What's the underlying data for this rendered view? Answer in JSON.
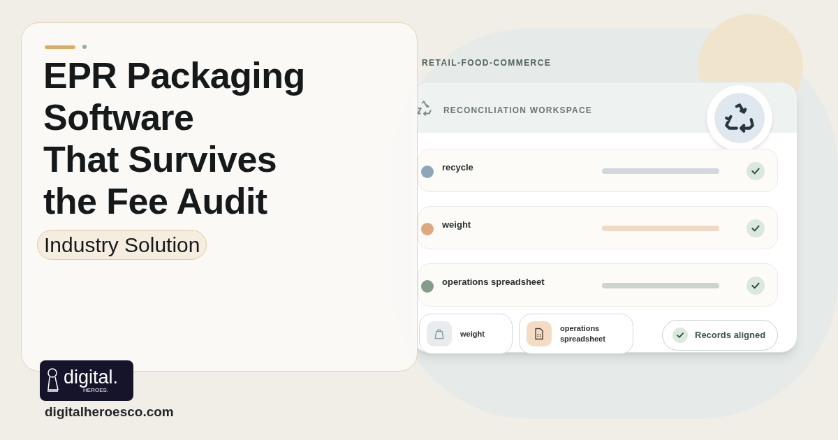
{
  "hero": {
    "title_lines": [
      "EPR Packaging",
      "Software",
      "That Survives",
      "the Fee Audit"
    ],
    "tag": "Industry Solution"
  },
  "panel": {
    "category": "RETAIL-FOOD-COMMERCE",
    "header": "RECONCILIATION WORKSPACE",
    "rows": [
      {
        "label": "recycle",
        "color": "#8fa5b8"
      },
      {
        "label": "weight",
        "color": "#dcaa7e"
      },
      {
        "label": "operations spreadsheet",
        "color": "#859c8a"
      }
    ],
    "chips": [
      {
        "kind": "weight",
        "label": "weight"
      },
      {
        "kind": "spreadsheet",
        "label": "operations spreadsheet"
      }
    ],
    "status": "Records aligned"
  },
  "brand": {
    "logo_text": "digital.",
    "logo_sub": "HEROES.",
    "url": "digitalheroesco.com"
  }
}
